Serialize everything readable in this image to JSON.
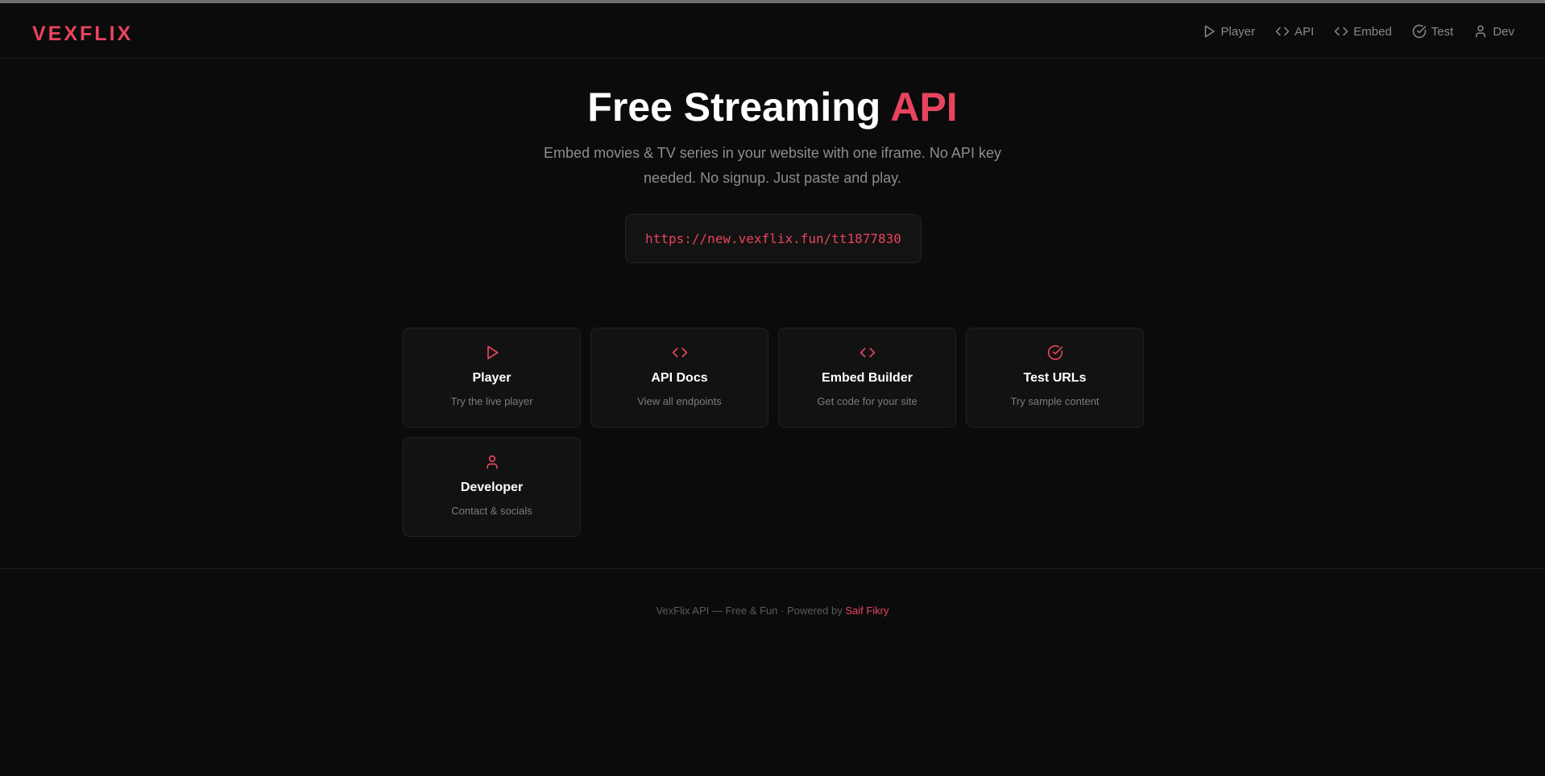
{
  "brand": {
    "logo": "VEXFLIX",
    "accent_color": "#e8445e"
  },
  "nav": {
    "items": [
      {
        "label": "Player",
        "icon": "play-icon"
      },
      {
        "label": "API",
        "icon": "code-icon"
      },
      {
        "label": "Embed",
        "icon": "code-icon"
      },
      {
        "label": "Test",
        "icon": "check-circle-icon"
      },
      {
        "label": "Dev",
        "icon": "user-icon"
      }
    ]
  },
  "hero": {
    "title_main": "Free Streaming ",
    "title_accent": "API",
    "subtitle": "Embed movies & TV series in your website with one iframe. No API key needed. No signup. Just paste and play.",
    "example_url": "https://new.vexflix.fun/tt1877830"
  },
  "cards": [
    {
      "title": "Player",
      "desc": "Try the live player",
      "icon": "play-icon"
    },
    {
      "title": "API Docs",
      "desc": "View all endpoints",
      "icon": "code-icon"
    },
    {
      "title": "Embed Builder",
      "desc": "Get code for your site",
      "icon": "code-icon"
    },
    {
      "title": "Test URLs",
      "desc": "Try sample content",
      "icon": "check-circle-icon"
    },
    {
      "title": "Developer",
      "desc": "Contact & socials",
      "icon": "user-icon"
    }
  ],
  "footer": {
    "text": "VexFlix API — Free & Fun · Powered by ",
    "link": "Saif Fikry"
  }
}
